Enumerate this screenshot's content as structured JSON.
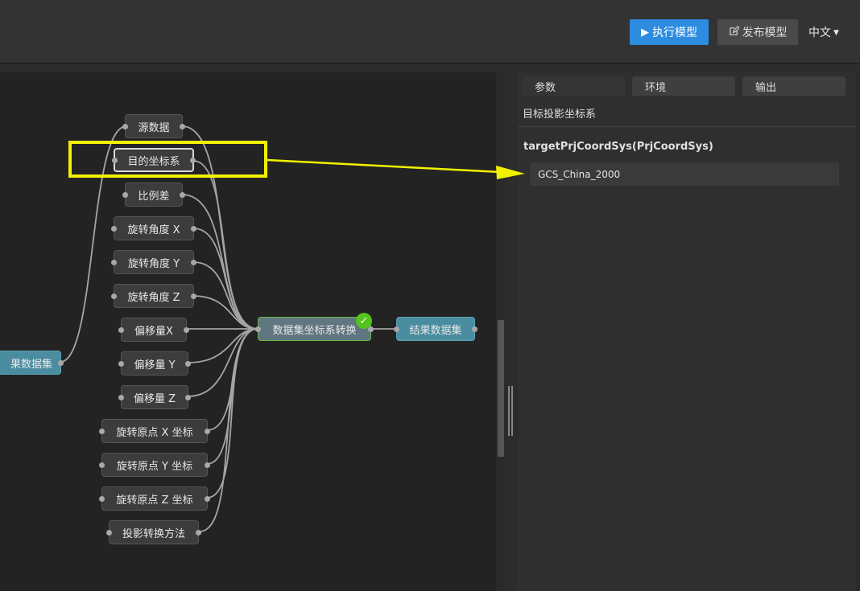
{
  "toolbar": {
    "run_label": "执行模型",
    "publish_label": "发布模型",
    "language": "中文"
  },
  "flow": {
    "inputs": [
      "源数据",
      "目的坐标系",
      "比例差",
      "旋转角度 X",
      "旋转角度 Y",
      "旋转角度 Z",
      "偏移量X",
      "偏移量 Y",
      "偏移量 Z",
      "旋转原点 X 坐标",
      "旋转原点 Y 坐标",
      "旋转原点 Z 坐标",
      "投影转换方法"
    ],
    "left_output": "果数据集",
    "process": "数据集坐标系转换",
    "result": "结果数据集",
    "status_check": "✓"
  },
  "panel": {
    "tabs": [
      "参数",
      "环境",
      "输出"
    ],
    "section_title": "目标投影坐标系",
    "param_name": "targetPrjCoordSys(PrjCoordSys)",
    "param_value": "GCS_China_2000"
  },
  "colors": {
    "run_button": "#2d8ce0",
    "highlight": "#f2f200",
    "success": "#52c41a",
    "node_teal": "#4a8da0"
  }
}
